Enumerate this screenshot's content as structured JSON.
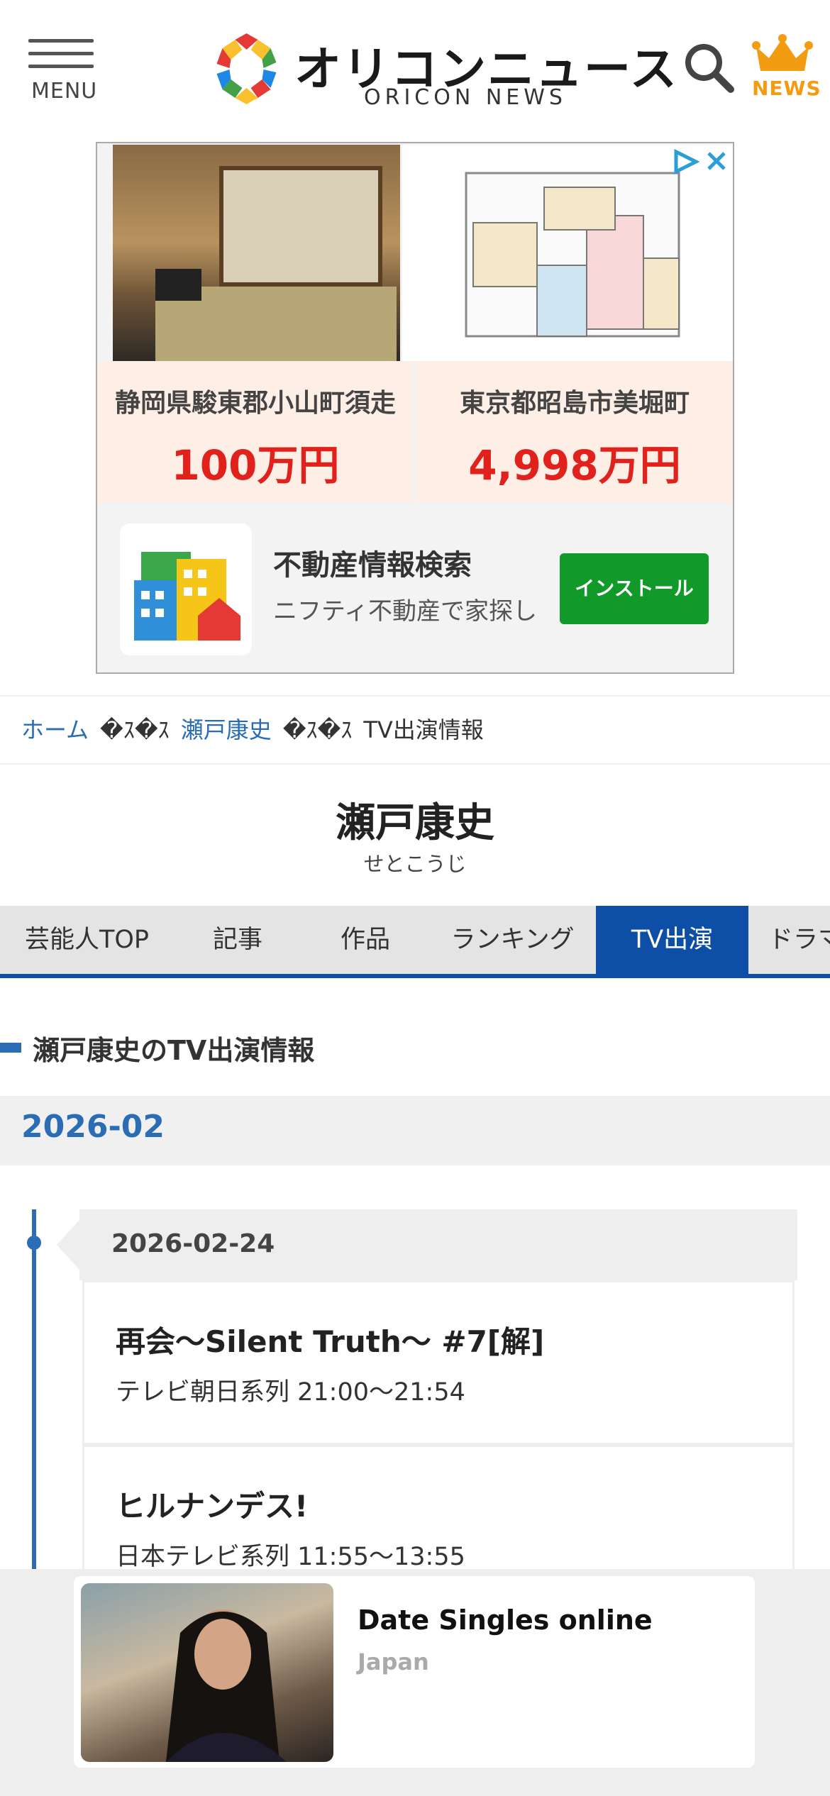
{
  "header": {
    "menu_label": "MENU",
    "logo_title": "オリコンニュース",
    "logo_sub": "ORICON NEWS",
    "news_label": "NEWS"
  },
  "ad": {
    "listings": [
      {
        "location": "静岡県駿東郡小山町須走",
        "price": "100万円"
      },
      {
        "location": "東京都昭島市美堀町",
        "price": "4,998万円"
      }
    ],
    "app_title": "不動産情報検索",
    "app_sub": "ニフティ不動産で家探し",
    "install_label": "インストール"
  },
  "breadcrumb": {
    "home": "ホーム",
    "sep": "�ｽ�ｽ",
    "person": "瀬戸康史",
    "current": "TV出演情報"
  },
  "person": {
    "name": "瀬戸康史",
    "kana": "せとこうじ"
  },
  "tabs": [
    {
      "label": "芸能人TOP"
    },
    {
      "label": "記事"
    },
    {
      "label": "作品"
    },
    {
      "label": "ランキング"
    },
    {
      "label": "TV出演"
    },
    {
      "label": "ドラマ"
    }
  ],
  "section": {
    "title": "瀬戸康史のTV出演情報"
  },
  "month": "2026-02",
  "date": "2026-02-24",
  "programs": [
    {
      "title": "再会～Silent Truth～ #7[解]",
      "time": "テレビ朝日系列 21:00～21:54"
    },
    {
      "title": "ヒルナンデス!",
      "time": "日本テレビ系列 11:55～13:55"
    }
  ],
  "sticky_ad": {
    "title": "Date Singles online",
    "sub": "Japan"
  },
  "colors": {
    "accent_blue": "#0d4fa6",
    "link_blue": "#2a6db5",
    "price_red": "#e0211c",
    "install_green": "#119a2a",
    "news_orange": "#f39c12"
  }
}
